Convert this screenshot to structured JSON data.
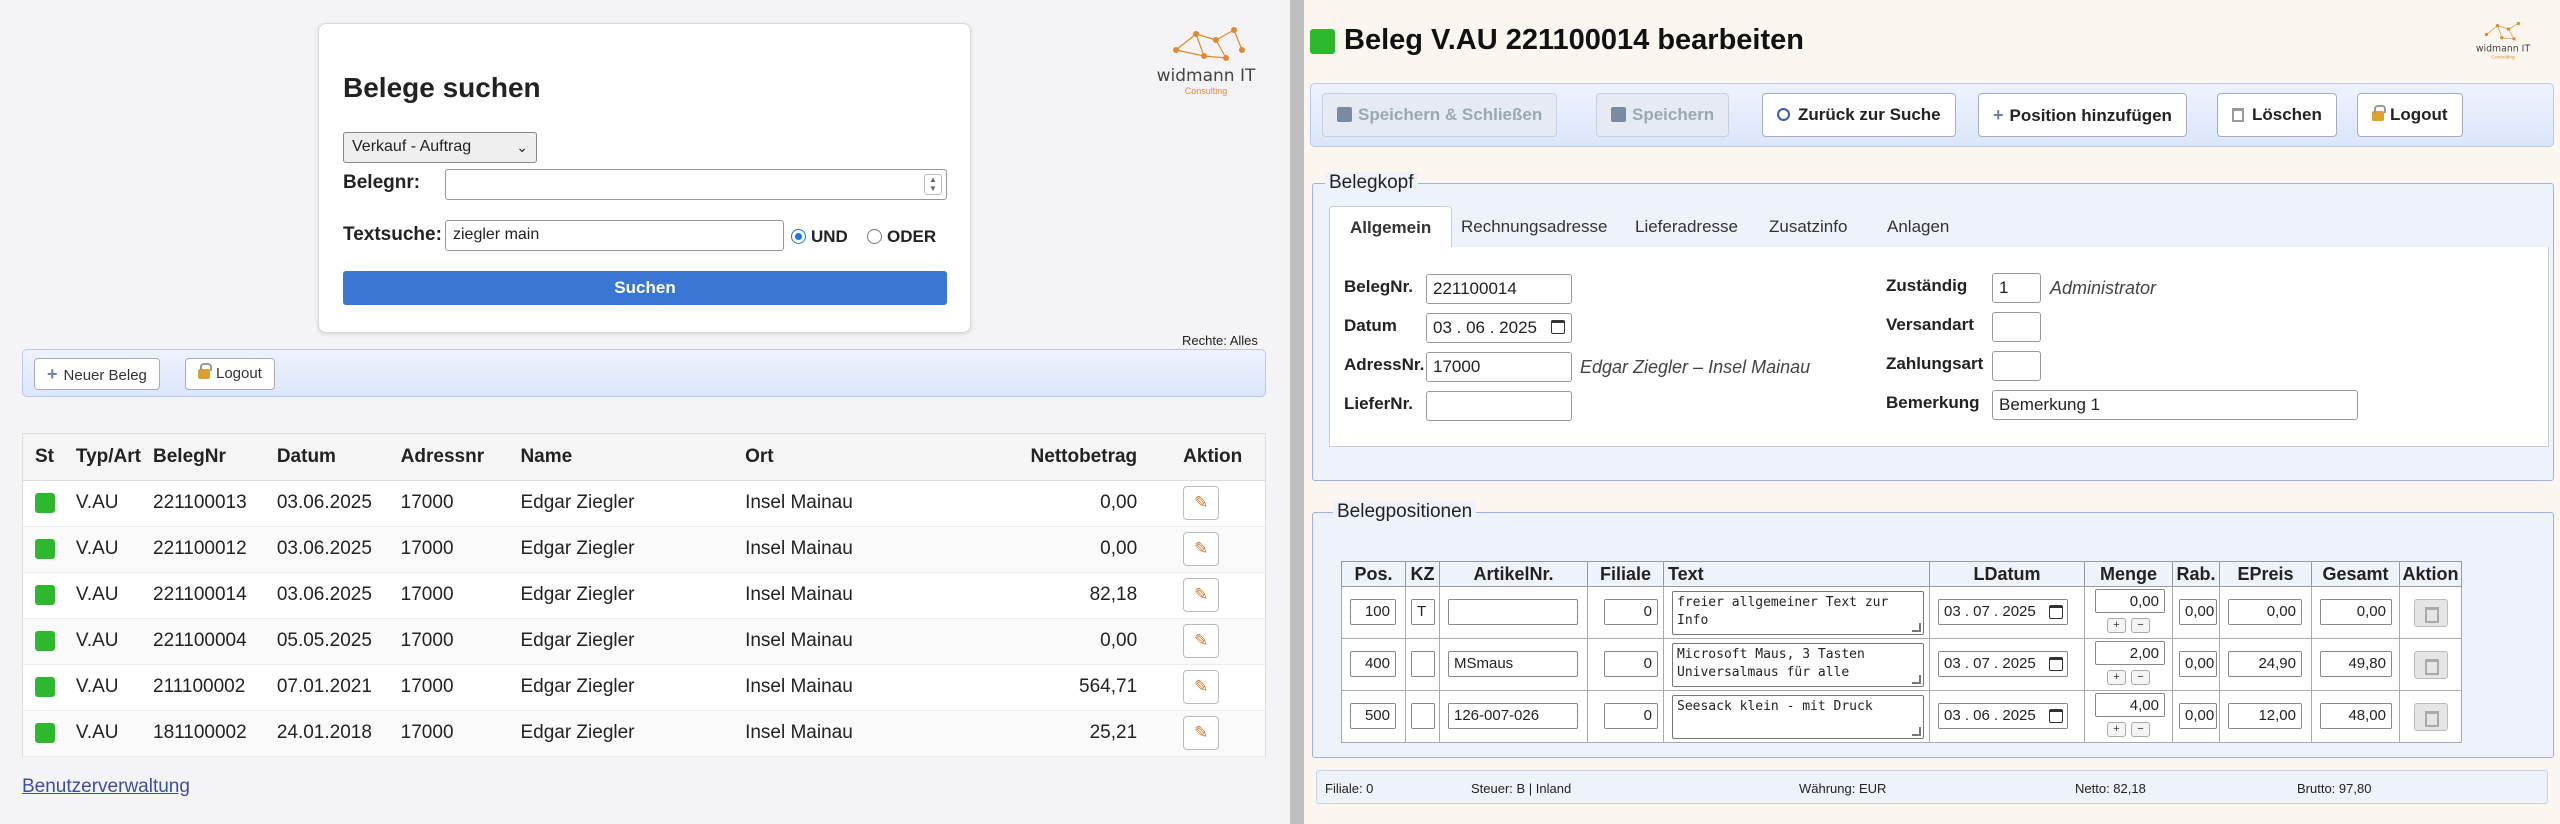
{
  "search": {
    "title": "Belege suchen",
    "type_select": "Verkauf - Auftrag",
    "belegnr_label": "Belegnr:",
    "belegnr_value": "",
    "textsuche_label": "Textsuche:",
    "textsuche_value": "ziegler main",
    "radio_und": "UND",
    "radio_oder": "ODER",
    "search_button": "Suchen"
  },
  "logo": {
    "brand": "widmann IT",
    "sub": "Consulting"
  },
  "rights": "Rechte: Alles",
  "left_toolbar": {
    "new_label": "Neuer Beleg",
    "logout_label": "Logout"
  },
  "results": {
    "headers": [
      "St",
      "Typ/Art",
      "BelegNr",
      "Datum",
      "Adressnr",
      "Name",
      "Ort",
      "Nettobetrag",
      "Aktion"
    ],
    "rows": [
      {
        "typ": "V.AU",
        "belegnr": "221100013",
        "datum": "03.06.2025",
        "adressnr": "17000",
        "name": "Edgar Ziegler",
        "ort": "Insel Mainau",
        "netto": "0,00"
      },
      {
        "typ": "V.AU",
        "belegnr": "221100012",
        "datum": "03.06.2025",
        "adressnr": "17000",
        "name": "Edgar Ziegler",
        "ort": "Insel Mainau",
        "netto": "0,00"
      },
      {
        "typ": "V.AU",
        "belegnr": "221100014",
        "datum": "03.06.2025",
        "adressnr": "17000",
        "name": "Edgar Ziegler",
        "ort": "Insel Mainau",
        "netto": "82,18"
      },
      {
        "typ": "V.AU",
        "belegnr": "221100004",
        "datum": "05.05.2025",
        "adressnr": "17000",
        "name": "Edgar Ziegler",
        "ort": "Insel Mainau",
        "netto": "0,00"
      },
      {
        "typ": "V.AU",
        "belegnr": "211100002",
        "datum": "07.01.2021",
        "adressnr": "17000",
        "name": "Edgar Ziegler",
        "ort": "Insel Mainau",
        "netto": "564,71"
      },
      {
        "typ": "V.AU",
        "belegnr": "181100002",
        "datum": "24.01.2018",
        "adressnr": "17000",
        "name": "Edgar Ziegler",
        "ort": "Insel Mainau",
        "netto": "25,21"
      }
    ],
    "status_color": "#2eb82e"
  },
  "user_admin_link": "Benutzerverwaltung",
  "edit": {
    "title": "Beleg V.AU 221100014 bearbeiten",
    "toolbar": {
      "save_close": "Speichern & Schließen",
      "save": "Speichern",
      "back": "Zurück zur Suche",
      "add_pos": "Position hinzufügen",
      "delete": "Löschen",
      "logout": "Logout"
    },
    "belegkopf": {
      "legend": "Belegkopf",
      "tabs": [
        "Allgemein",
        "Rechnungsadresse",
        "Lieferadresse",
        "Zusatzinfo",
        "Anlagen"
      ],
      "belegnr_label": "BelegNr.",
      "belegnr_value": "221100014",
      "datum_label": "Datum",
      "datum_value": "03 . 06 . 2025",
      "adressnr_label": "AdressNr.",
      "adressnr_value": "17000",
      "adress_text": "Edgar Ziegler – Insel Mainau",
      "liefernr_label": "LieferNr.",
      "liefernr_value": "",
      "zustaendig_label": "Zuständig",
      "zustaendig_value": "1",
      "zustaendig_text": "Administrator",
      "versandart_label": "Versandart",
      "versandart_value": "",
      "zahlungsart_label": "Zahlungsart",
      "zahlungsart_value": "",
      "bemerkung_label": "Bemerkung",
      "bemerkung_value": "Bemerkung 1"
    },
    "positionen": {
      "legend": "Belegpositionen",
      "headers": [
        "Pos.",
        "KZ",
        "ArtikelNr.",
        "Filiale",
        "Text",
        "LDatum",
        "Menge",
        "Rab.",
        "EPreis",
        "Gesamt",
        "Aktion"
      ],
      "rows": [
        {
          "pos": "100",
          "kz": "T",
          "artikel": "",
          "filiale": "0",
          "text": "freier allgemeiner Text zur Info",
          "ldatum": "03 . 07 . 2025",
          "menge": "0,00",
          "rab": "0,00",
          "epreis": "0,00",
          "gesamt": "0,00"
        },
        {
          "pos": "400",
          "kz": "",
          "artikel": "MSmaus",
          "filiale": "0",
          "text": "Microsoft Maus, 3 Tasten Universalmaus für alle",
          "ldatum": "03 . 07 . 2025",
          "menge": "2,00",
          "rab": "0,00",
          "epreis": "24,90",
          "gesamt": "49,80"
        },
        {
          "pos": "500",
          "kz": "",
          "artikel": "126-007-026",
          "filiale": "0",
          "text": "Seesack klein - mit Druck",
          "ldatum": "03 . 06 . 2025",
          "menge": "4,00",
          "rab": "0,00",
          "epreis": "12,00",
          "gesamt": "48,00"
        }
      ]
    },
    "status": {
      "filiale": "Filiale: 0",
      "steuer": "Steuer: B | Inland",
      "waehrung": "Währung: EUR",
      "netto": "Netto: 82,18",
      "brutto": "Brutto: 97,80"
    }
  }
}
